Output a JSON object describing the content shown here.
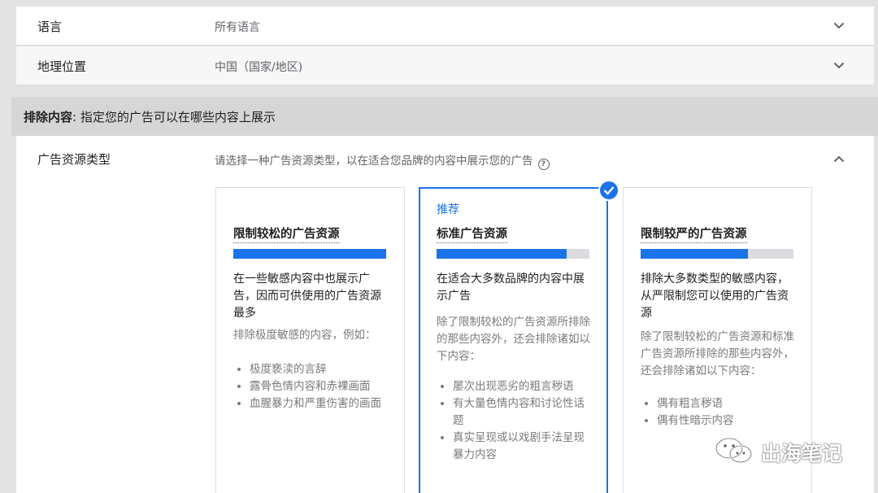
{
  "rows": [
    {
      "label": "语言",
      "value": "所有语言"
    },
    {
      "label": "地理位置",
      "value": "中国（国家/地区)"
    }
  ],
  "exclusion": {
    "title_bold": "排除内容",
    "title_rest": ": 指定您的广告可以在哪些内容上展示"
  },
  "inventory": {
    "label": "广告资源类型",
    "hint": "请选择一种广告资源类型，以在适合您品牌的内容中展示您的广告",
    "help_icon": "?"
  },
  "cards": [
    {
      "recommended": "",
      "name": "限制较松的广告资源",
      "level": 1.0,
      "summary": "在一些敏感内容中也展示广告，因而可供使用的广告资源最多",
      "detail": "排除极度敏感的内容，例如：",
      "items": [
        "极度亵渎的言辞",
        "露骨色情内容和赤裸画面",
        "血腥暴力和严重伤害的画面"
      ]
    },
    {
      "recommended": "推荐",
      "name": "标准广告资源",
      "level": 0.85,
      "summary": "在适合大多数品牌的内容中展示广告",
      "detail": "除了限制较松的广告资源所排除的那些内容外，还会排除诸如以下内容：",
      "items": [
        "屡次出现恶劣的粗言秽语",
        "有大量色情内容和讨论性话题",
        "真实呈现或以戏剧手法呈现暴力内容"
      ]
    },
    {
      "recommended": "",
      "name": "限制较严的广告资源",
      "level": 0.7,
      "summary": "排除大多数类型的敏感内容，从严限制您可以使用的广告资源",
      "detail": "除了限制较松的广告资源和标准广告资源所排除的那些内容外，还会排除诸如以下内容：",
      "items": [
        "偶有粗言秽语",
        "偶有性暗示内容"
      ]
    }
  ],
  "watermark": {
    "text": "出海笔记",
    "icon": "wechat-icon"
  },
  "colors": {
    "accent": "#1a73e8",
    "track": "#dadce0"
  }
}
